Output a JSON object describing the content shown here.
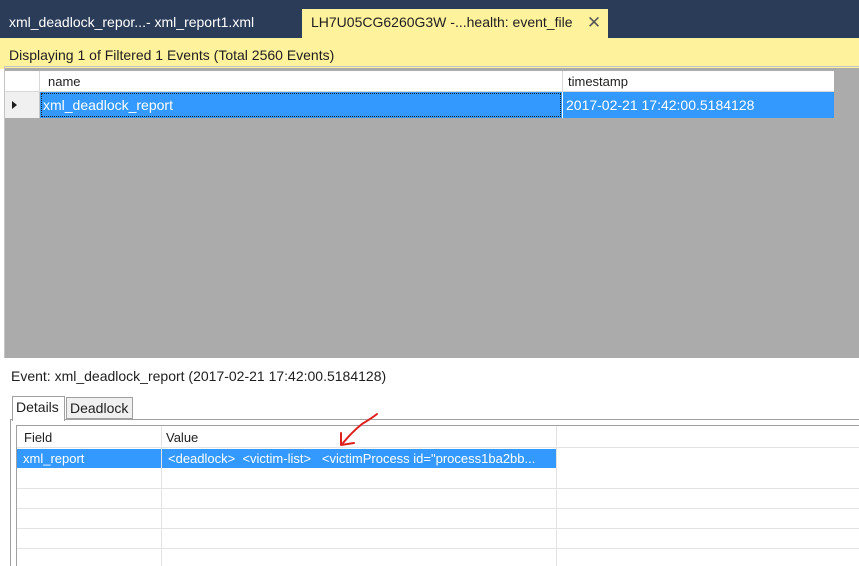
{
  "tabs": [
    {
      "label": "xml_deadlock_repor...- xml_report1.xml",
      "active": false
    },
    {
      "label": "LH7U05CG6260G3W -...health: event_file",
      "active": true,
      "close_glyph": "✕"
    }
  ],
  "banner": {
    "text": "Displaying 1 of Filtered 1 Events (Total 2560 Events)"
  },
  "events_grid": {
    "columns": [
      "name",
      "timestamp"
    ],
    "rows": [
      {
        "name": "xml_deadlock_report",
        "timestamp": "2017-02-21 17:42:00.5184128",
        "selected": true
      }
    ]
  },
  "event_detail": {
    "caption": "Event: xml_deadlock_report (2017-02-21 17:42:00.5184128)",
    "tabs": [
      {
        "label": "Details",
        "selected": true
      },
      {
        "label": "Deadlock",
        "selected": false
      }
    ],
    "grid": {
      "columns": [
        "Field",
        "Value"
      ],
      "rows": [
        {
          "field": "xml_report",
          "value": "<deadlock>  <victim-list>   <victimProcess id=\"process1ba2bb...",
          "selected": true
        }
      ]
    }
  },
  "colors": {
    "tabstrip": "#2b3c59",
    "active_tab": "#fff29d",
    "selection": "#3399ff",
    "empty_grid": "#ababab",
    "annotation": "#e0201c"
  },
  "icons": [
    "close-icon",
    "row-pointer-icon"
  ]
}
